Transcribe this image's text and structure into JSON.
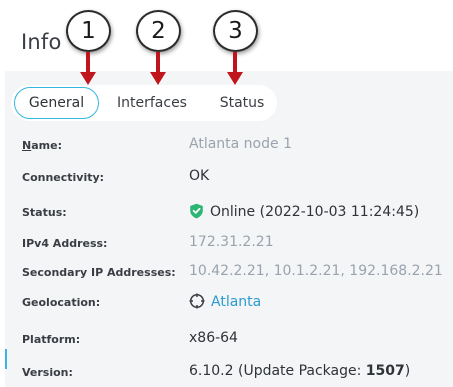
{
  "header": {
    "title": "Info"
  },
  "callouts": [
    "1",
    "2",
    "3"
  ],
  "tabs": {
    "general": "General",
    "interfaces": "Interfaces",
    "status": "Status"
  },
  "fields": {
    "name": {
      "label_first": "N",
      "label_rest": "ame:",
      "value": "Atlanta node 1"
    },
    "connectivity": {
      "label": "Connectivity:",
      "value": "OK"
    },
    "status": {
      "label": "Status:",
      "value": "Online (2022-10-03 11:24:45)",
      "icon": "shield-check-icon"
    },
    "ipv4": {
      "label": "IPv4 Address:",
      "value": "172.31.2.21"
    },
    "secondary_ips": {
      "label": "Secondary IP Addresses:",
      "value": "10.42.2.21, 10.1.2.21, 192.168.2.21"
    },
    "geolocation": {
      "label": "Geolocation:",
      "value": "Atlanta",
      "icon": "crosshair-icon"
    },
    "platform": {
      "label": "Platform:",
      "value": "x86-64"
    },
    "version": {
      "label": "Version:",
      "value_prefix": "6.10.2 (Update Package: ",
      "value_bold": "1507",
      "value_suffix": ")"
    }
  },
  "colors": {
    "accent": "#35b6e3",
    "status_green": "#2bb673",
    "link": "#2b9bd1",
    "arrow_red": "#c0161b"
  }
}
